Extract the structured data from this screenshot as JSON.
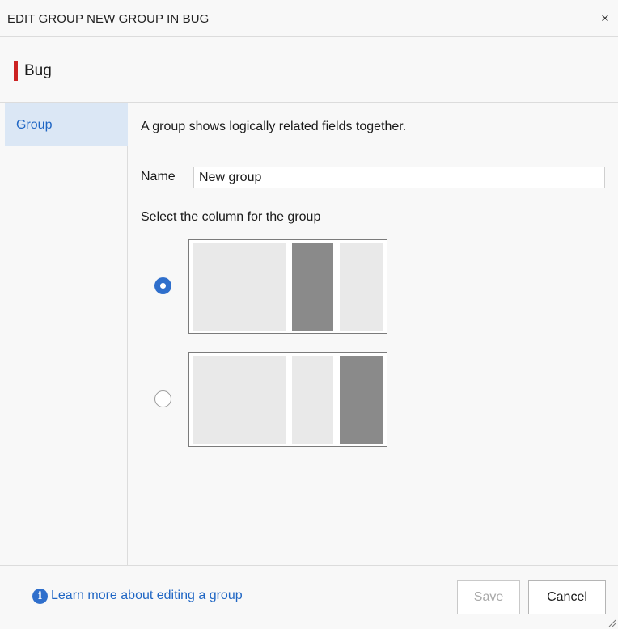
{
  "dialog": {
    "title": "EDIT GROUP NEW GROUP IN BUG",
    "close_glyph": "×"
  },
  "work_item": {
    "name": "Bug",
    "color": "#cc2222"
  },
  "sidebar": {
    "items": [
      {
        "label": "Group",
        "selected": true
      }
    ]
  },
  "content": {
    "description": "A group shows logically related fields together.",
    "name_label": "Name",
    "name_value": "New group",
    "column_label": "Select the column for the group",
    "layout_options": [
      {
        "selected": true,
        "highlighted_column": 2
      },
      {
        "selected": false,
        "highlighted_column": 3
      }
    ]
  },
  "footer": {
    "info_glyph": "i",
    "learn_more": "Learn more about editing a group",
    "save_label": "Save",
    "cancel_label": "Cancel"
  },
  "icons": {
    "close": "close-icon",
    "info": "info-icon",
    "resize": "resize-grip-icon"
  },
  "colors": {
    "accent": "#2f6fcc",
    "selected_bg": "#dbe7f5",
    "link": "#1f66c4"
  }
}
